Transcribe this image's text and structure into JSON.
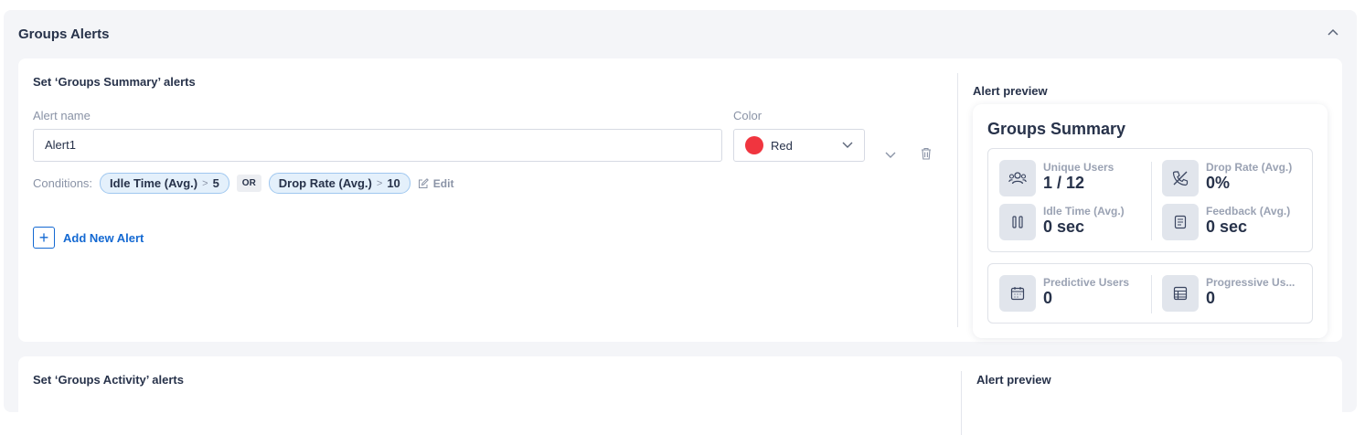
{
  "section": {
    "title": "Groups Alerts"
  },
  "summary_card": {
    "title": "Set ‘Groups Summary’ alerts",
    "alert_name_label": "Alert name",
    "alert_name_value": "Alert1",
    "color_label": "Color",
    "color_value": "Red",
    "color_hex": "#f0353f",
    "conditions_label": "Conditions:",
    "conditions": [
      {
        "field": "Idle Time (Avg.)",
        "operator": ">",
        "value": "5"
      },
      {
        "field": "Drop Rate (Avg.)",
        "operator": ">",
        "value": "10"
      }
    ],
    "joiner": "OR",
    "edit_label": "Edit",
    "add_label": "Add New Alert",
    "preview_label": "Alert preview",
    "preview": {
      "title": "Groups Summary",
      "stats": [
        {
          "name": "Unique Users",
          "value": "1 / 12",
          "icon": "users-icon"
        },
        {
          "name": "Drop Rate (Avg.)",
          "value": "0%",
          "icon": "phone-off-icon"
        },
        {
          "name": "Idle Time (Avg.)",
          "value": "0 sec",
          "icon": "pause-icon"
        },
        {
          "name": "Feedback (Avg.)",
          "value": "0 sec",
          "icon": "document-icon"
        },
        {
          "name": "Predictive Users",
          "value": "0",
          "icon": "calendar-icon"
        },
        {
          "name": "Progressive Us...",
          "value": "0",
          "icon": "table-icon"
        }
      ]
    }
  },
  "activity_card": {
    "title": "Set ‘Groups Activity’ alerts",
    "preview_label": "Alert preview"
  },
  "accent": "#1469d2"
}
